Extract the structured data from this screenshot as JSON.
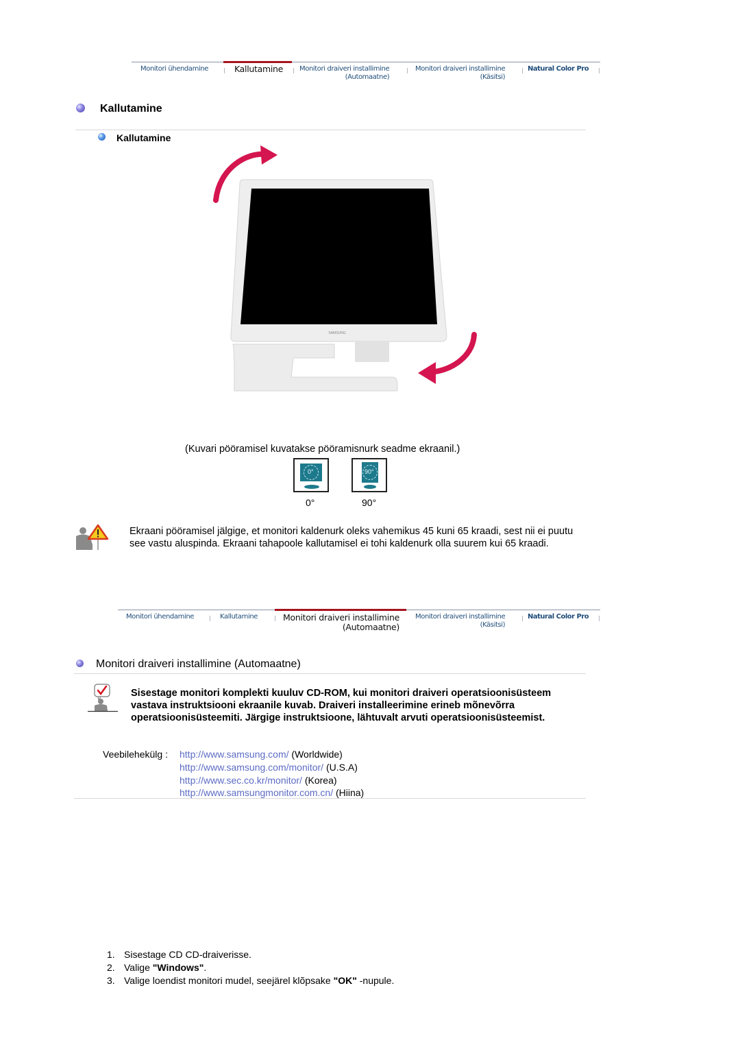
{
  "nav_tabs": [
    {
      "label": "Monitori ühendamine",
      "sub": ""
    },
    {
      "label": "Kallutamine",
      "sub": ""
    },
    {
      "label": "Monitori draiveri installimine",
      "sub": "(Automaatne)"
    },
    {
      "label": "Monitori draiveri installimine",
      "sub": "(Käsitsi)"
    },
    {
      "label": "Natural Color Pro",
      "sub": ""
    }
  ],
  "section1": {
    "active_tab_index": 1,
    "title": "Kallutamine",
    "subtitle": "Kallutamine",
    "figure": {
      "brand": "SAMSUNG",
      "description": "monitor-tilt-illustration",
      "arrow_color": "#d4154f"
    },
    "caption": "(Kuvari pööramisel kuvatakse pööramisnurk seadme ekraanil.)",
    "rotation_icons": [
      {
        "label": "0°",
        "screen_text": "0°"
      },
      {
        "label": "90°",
        "screen_text": "90°"
      }
    ],
    "warning_text": "Ekraani pööramisel jälgige, et monitori kaldenurk oleks vahemikus 45 kuni 65 kraadi, sest nii ei puutu see vastu aluspinda. Ekraani tahapoole kallutamisel ei tohi kaldenurk olla suurem kui 65 kraadi."
  },
  "section2": {
    "active_tab_index": 2,
    "title": "Monitori draiveri installimine (Automaatne)",
    "note_text": "Sisestage monitori komplekti kuuluv CD-ROM, kui monitori draiveri operatsioonisüsteem vastava instruktsiooni ekraanile kuvab. Draiveri installeerimine erineb mõnevõrra operatsioonisüsteemiti. Järgige instruktsioone, lähtuvalt arvuti operatsioonisüsteemist.",
    "website_label": "Veebilehekülg :",
    "websites": [
      {
        "url": "http://www.samsung.com/",
        "region": "(Worldwide)"
      },
      {
        "url": "http://www.samsung.com/monitor/",
        "region": "(U.S.A)"
      },
      {
        "url": "http://www.sec.co.kr/monitor/",
        "region": "(Korea)"
      },
      {
        "url": "http://www.samsungmonitor.com.cn/",
        "region": "(Hiina)"
      }
    ],
    "steps": [
      {
        "num": "1.",
        "pre": "Sisestage CD CD-draiverisse.",
        "bold": "",
        "post": ""
      },
      {
        "num": "2.",
        "pre": "Valige ",
        "bold": "\"Windows\"",
        "post": "."
      },
      {
        "num": "3.",
        "pre": "Valige loendist monitori mudel, seejärel klõpsake ",
        "bold": "\"OK\"",
        "post": " -nupule."
      }
    ]
  },
  "colors": {
    "nav_text": "#1f4d7a",
    "nav_active_bar": "#a8141e",
    "link": "#5c6cc4",
    "arrow": "#d4154f"
  }
}
